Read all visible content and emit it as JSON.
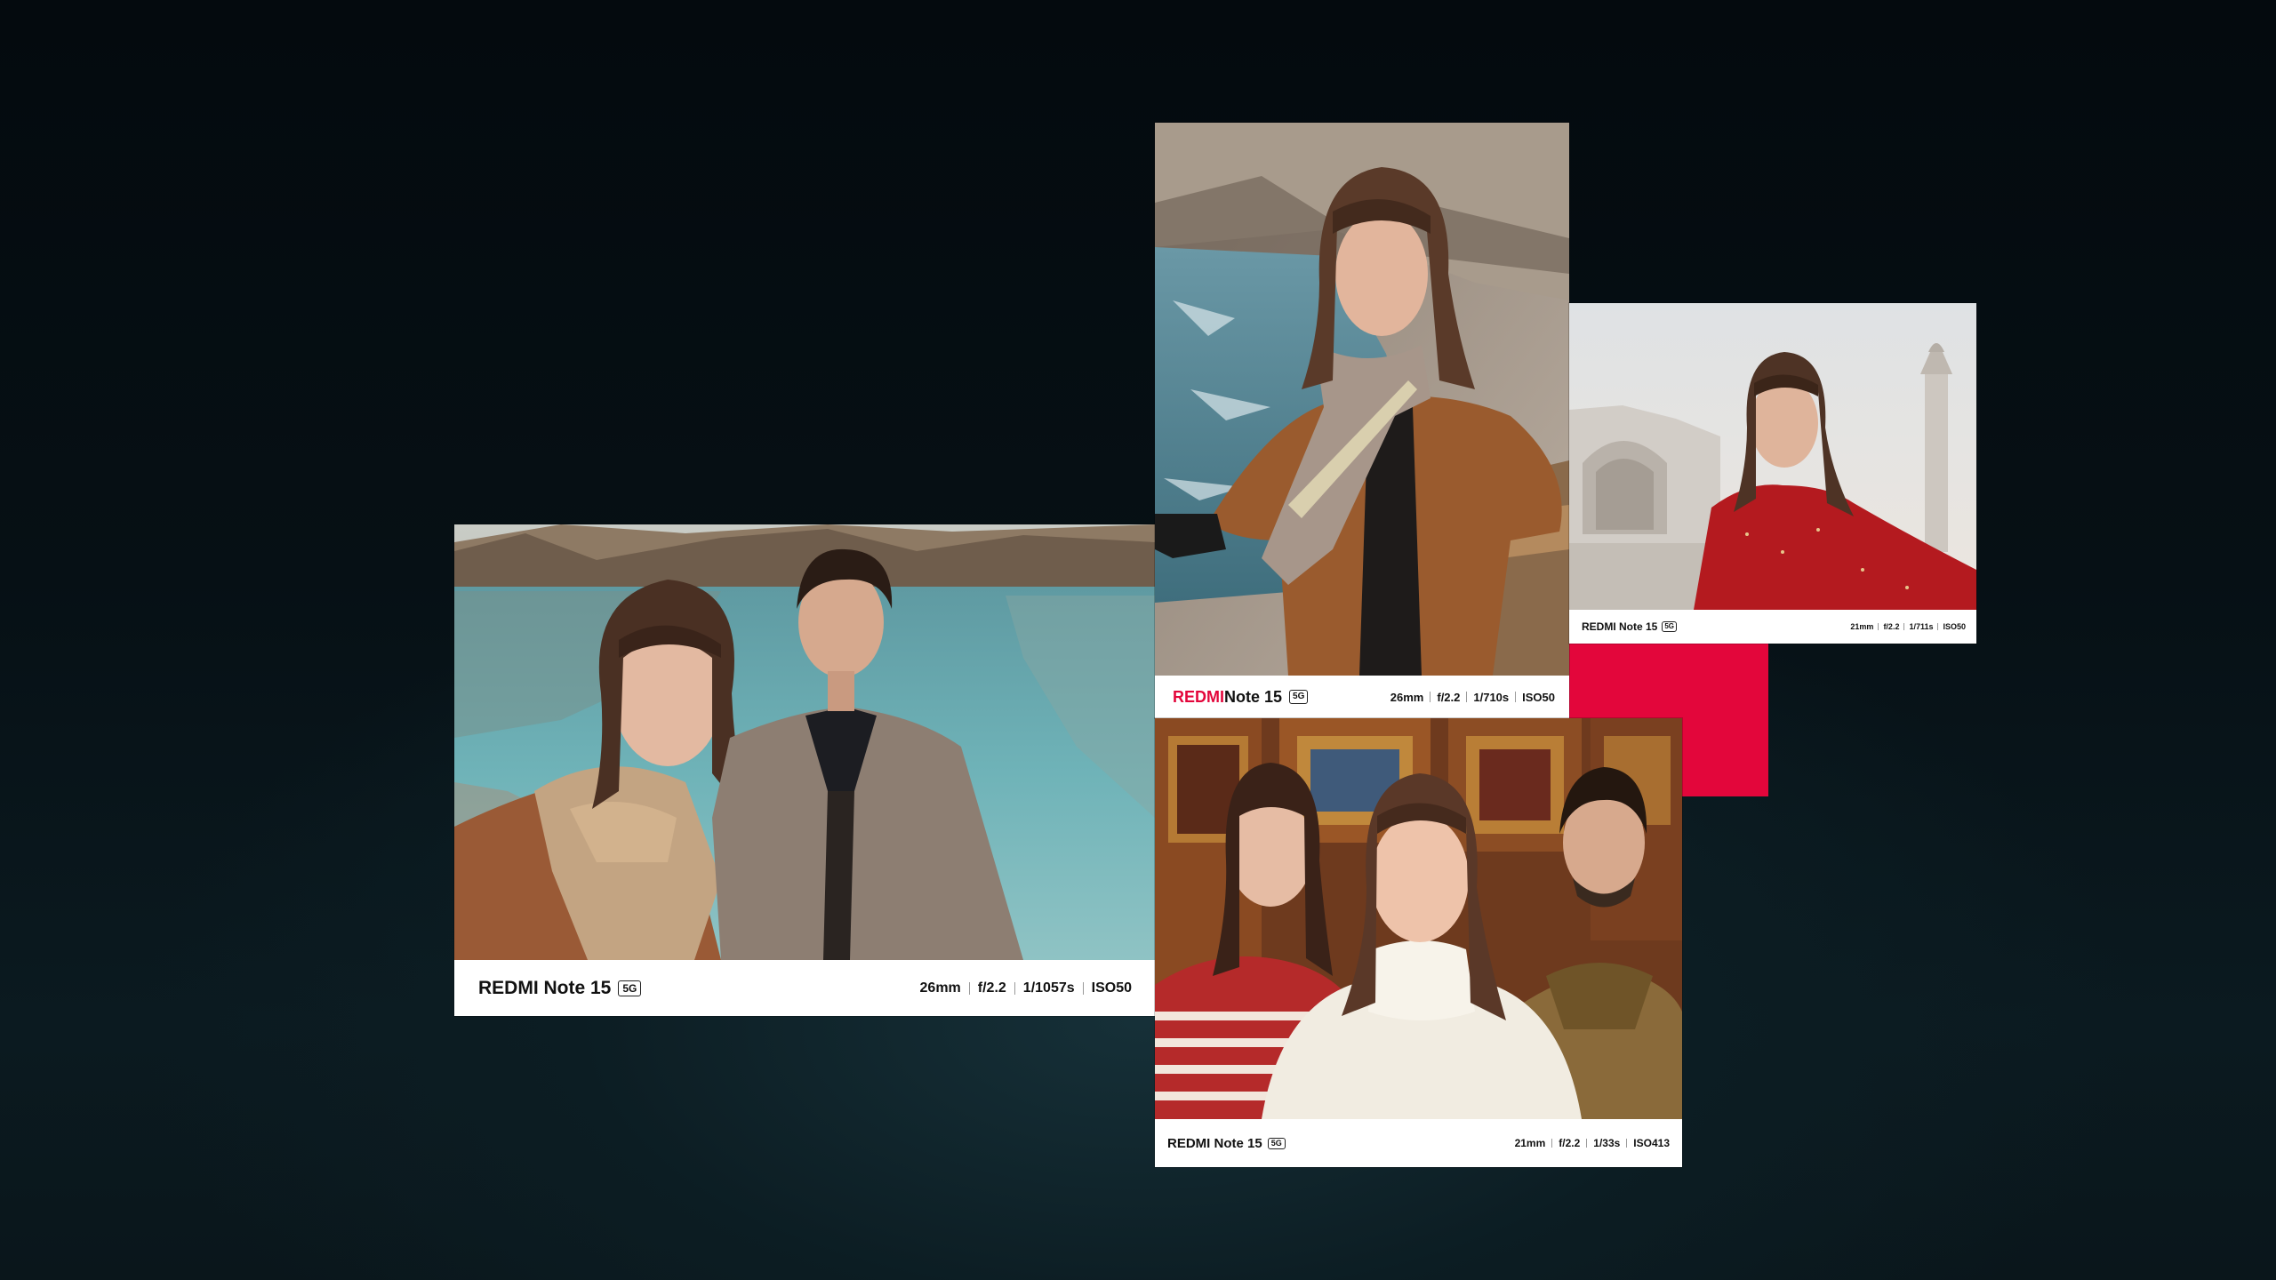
{
  "colors": {
    "accent": "#e3063b",
    "background": "#050b0f",
    "strip": "#ffffff"
  },
  "cards": [
    {
      "scene": "lake",
      "brand_red": "",
      "brand_rest": "REDMI Note 15",
      "badge": "5G",
      "specs": [
        "26mm",
        "f/2.2",
        "1/1057s",
        "ISO50"
      ]
    },
    {
      "scene": "river",
      "brand_red": "REDMI",
      "brand_rest": " Note 15",
      "badge": "5G",
      "specs": [
        "26mm",
        "f/2.2",
        "1/710s",
        "ISO50"
      ]
    },
    {
      "scene": "taj",
      "brand_red": "",
      "brand_rest": "REDMI Note 15",
      "badge": "5G",
      "specs": [
        "21mm",
        "f/2.2",
        "1/711s",
        "ISO50"
      ]
    },
    {
      "scene": "indoor",
      "brand_red": "",
      "brand_rest": "REDMI Note 15",
      "badge": "5G",
      "specs": [
        "21mm",
        "f/2.2",
        "1/33s",
        "ISO413"
      ]
    }
  ]
}
